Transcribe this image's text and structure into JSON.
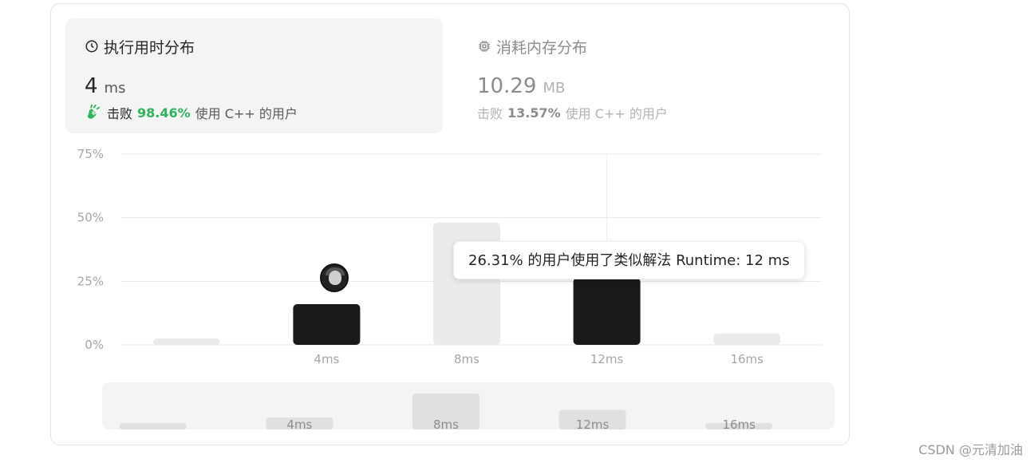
{
  "runtime_panel": {
    "title": "执行用时分布",
    "value": "4",
    "unit": "ms",
    "beat_prefix": "击败",
    "beat_pct": "98.46%",
    "beat_suffix": "使用 C++ 的用户"
  },
  "memory_panel": {
    "title": "消耗内存分布",
    "value": "10.29",
    "unit": "MB",
    "beat_prefix": "击败",
    "beat_pct": "13.57%",
    "beat_suffix": "使用 C++ 的用户"
  },
  "tooltip": {
    "text": "26.31% 的用户使用了类似解法 Runtime: 12 ms"
  },
  "colors": {
    "accent_green": "#2db55d",
    "bar_highlight": "#1a1a1a",
    "bar_normal": "#ebebeb",
    "grid": "#e8e8e8"
  },
  "chart_data": {
    "type": "bar",
    "categories": [
      "",
      "4ms",
      "8ms",
      "12ms",
      "16ms"
    ],
    "values": [
      2.5,
      16,
      48,
      26.31,
      4.5
    ],
    "highlighted": [
      "4ms",
      "12ms"
    ],
    "yticks": [
      "0%",
      "25%",
      "50%",
      "75%"
    ],
    "ylim": [
      0,
      75
    ],
    "grid": true,
    "overview_values": [
      2.5,
      16,
      48,
      26.31,
      4.5
    ],
    "overview_labels": [
      "",
      "4ms",
      "8ms",
      "12ms",
      "16ms"
    ]
  },
  "watermark": "CSDN @元清加油"
}
